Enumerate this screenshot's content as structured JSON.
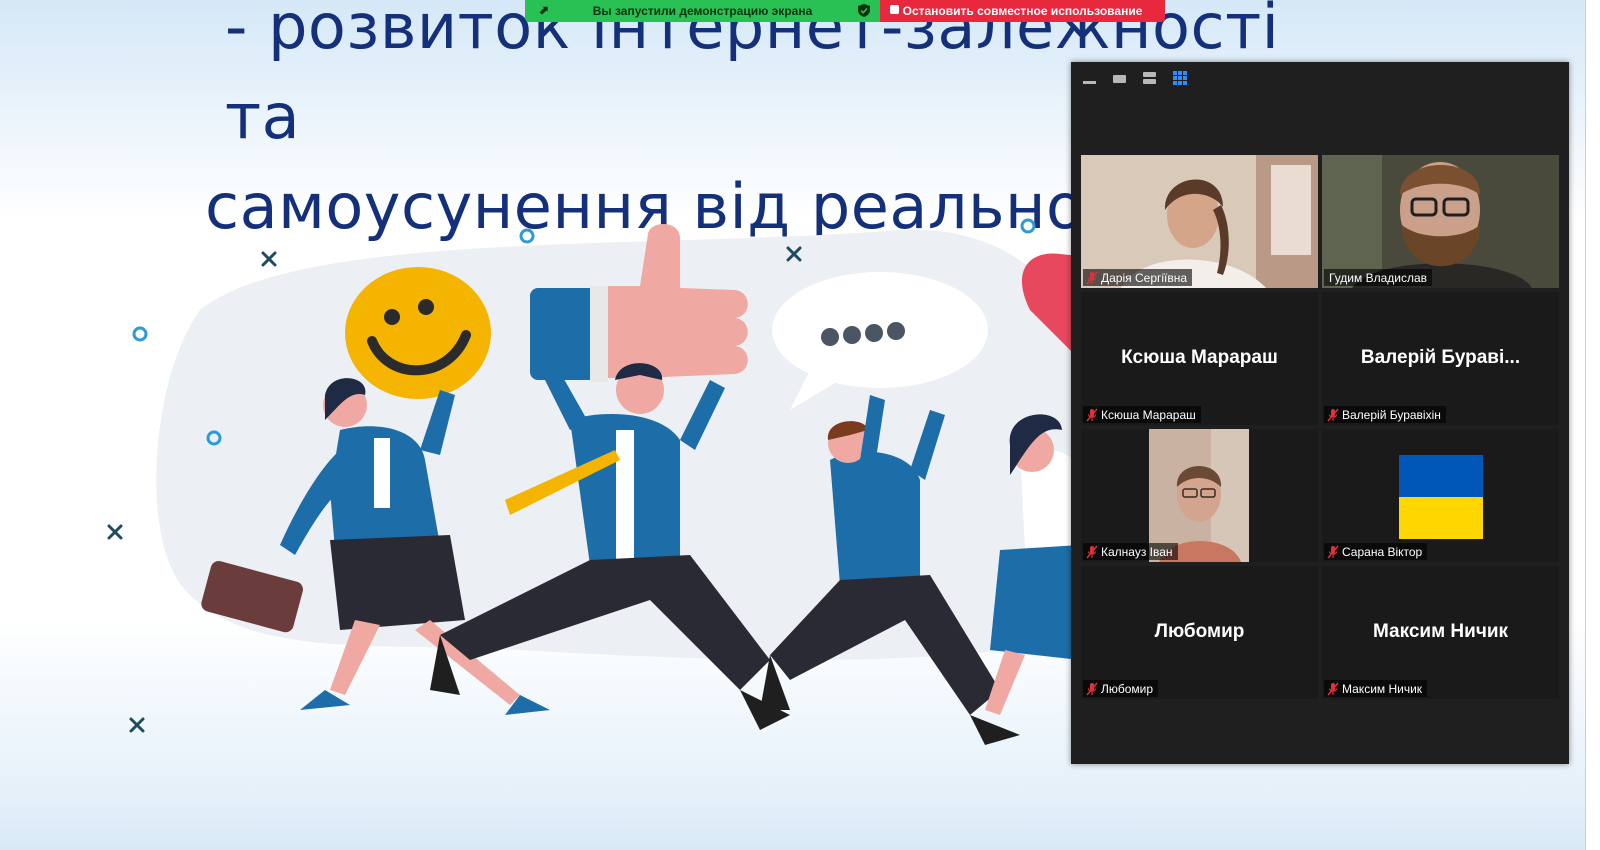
{
  "share_bar": {
    "status_text": "Вы запустили демонстрацию экрана",
    "stop_label": "Остановить совместное использование",
    "status_color": "#2ac154",
    "stop_color": "#e8283d"
  },
  "slide": {
    "title_line1": "- розвиток інтернет-залежності та",
    "title_line2": "самоусунення від реального"
  },
  "gallery": {
    "accent": "#2d8cff",
    "toolbar": [
      "minimize-icon",
      "speaker-view-icon",
      "strip-view-icon",
      "gallery-view-icon"
    ],
    "participants": [
      {
        "name": "Дарія Сергіївна",
        "display": "",
        "type": "video",
        "muted": true
      },
      {
        "name": "Гудим Владислав",
        "display": "",
        "type": "video",
        "muted": true
      },
      {
        "name": "Ксюша Марараш",
        "display": "Ксюша Марараш",
        "type": "name",
        "muted": true
      },
      {
        "name": "Валерій Буравіхін",
        "display": "Валерій Бураві...",
        "type": "name",
        "muted": true
      },
      {
        "name": "Калнауз Іван",
        "display": "",
        "type": "video",
        "muted": true,
        "active": true
      },
      {
        "name": "Сарана Віктор",
        "display": "",
        "type": "flag",
        "muted": true
      },
      {
        "name": "Любомир",
        "display": "Любомир",
        "type": "name",
        "muted": true
      },
      {
        "name": "Максим Ничик",
        "display": "Максим Ничик",
        "type": "name",
        "muted": true
      }
    ]
  }
}
